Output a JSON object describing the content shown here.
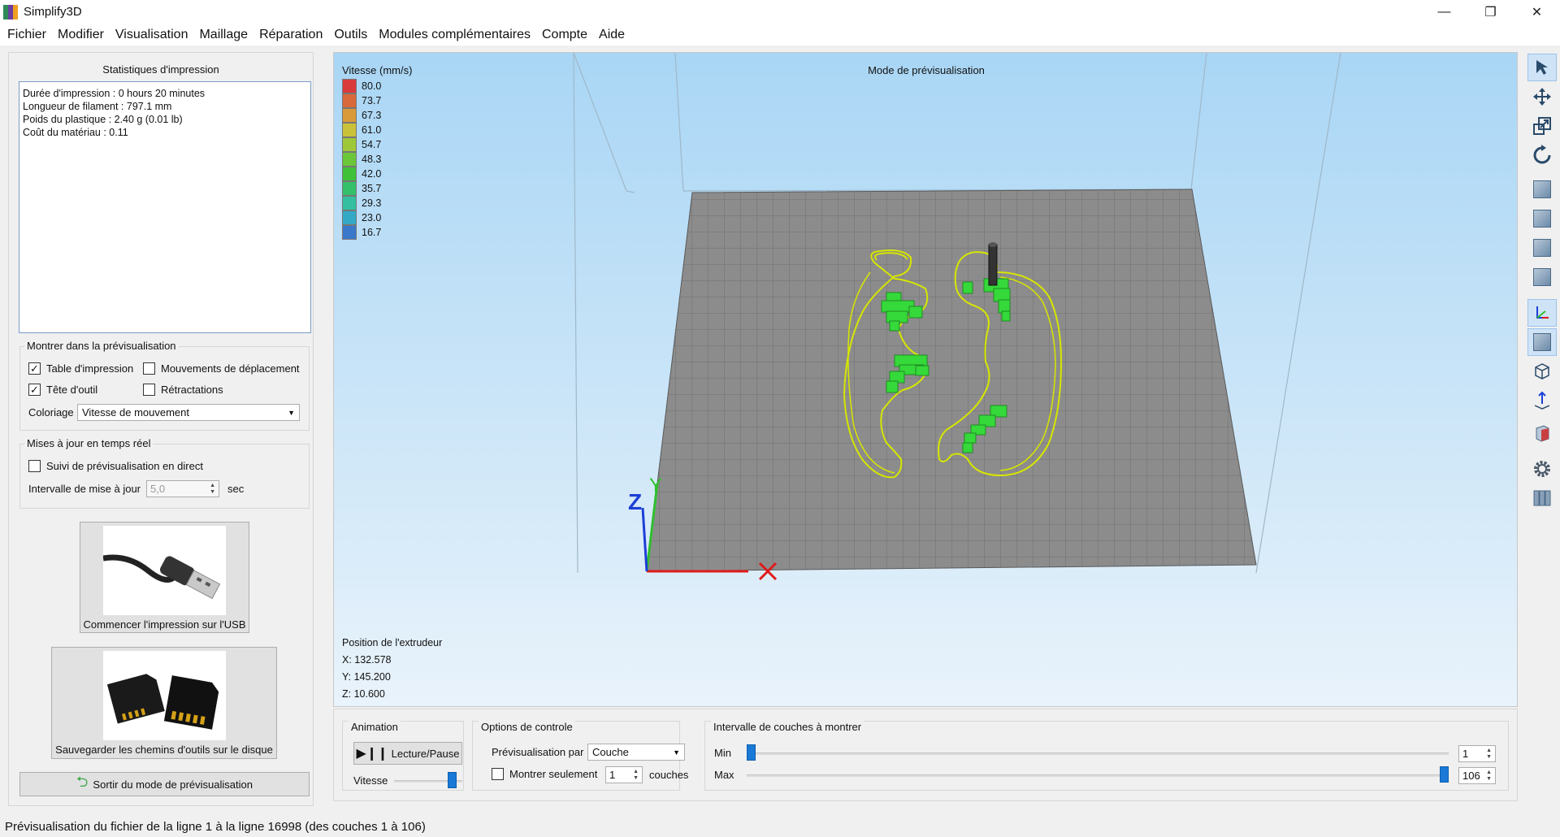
{
  "window": {
    "title": "Simplify3D",
    "minimize": "—",
    "maximize": "❐",
    "close": "✕"
  },
  "menu": [
    "Fichier",
    "Modifier",
    "Visualisation",
    "Maillage",
    "Réparation",
    "Outils",
    "Modules complémentaires",
    "Compte",
    "Aide"
  ],
  "stats": {
    "title": "Statistiques d'impression",
    "lines": [
      "Durée d'impression : 0 hours 20 minutes",
      "Longueur de filament : 797.1 mm",
      "Poids du plastique : 2.40 g (0.01 lb)",
      "Coût du matériau : 0.11"
    ]
  },
  "preview_show": {
    "title": "Montrer dans la prévisualisation",
    "options": [
      {
        "label": "Table d'impression",
        "checked": true
      },
      {
        "label": "Mouvements de déplacement",
        "checked": false
      },
      {
        "label": "Tête d'outil",
        "checked": true
      },
      {
        "label": "Rétractations",
        "checked": false
      }
    ],
    "coloring_label": "Coloriage",
    "coloring_value": "Vitesse de mouvement"
  },
  "realtime": {
    "title": "Mises à jour en temps réel",
    "live_label": "Suivi de prévisualisation en direct",
    "live_checked": false,
    "interval_label": "Intervalle de mise à jour",
    "interval_value": "5,0",
    "interval_unit": "sec"
  },
  "actions": {
    "usb_label": "Commencer l'impression sur l'USB",
    "sd_label": "Sauvegarder les chemins d'outils sur le disque",
    "exit_label": "Sortir du mode de prévisualisation"
  },
  "viewport": {
    "title": "Mode de prévisualisation",
    "legend_title": "Vitesse (mm/s)",
    "legend": [
      {
        "value": "80.0",
        "color": "#d93a3a"
      },
      {
        "value": "73.7",
        "color": "#d9683a"
      },
      {
        "value": "67.3",
        "color": "#d99a3a"
      },
      {
        "value": "61.0",
        "color": "#c9c23a"
      },
      {
        "value": "54.7",
        "color": "#9ec83a"
      },
      {
        "value": "48.3",
        "color": "#6cc63a"
      },
      {
        "value": "42.0",
        "color": "#3fc23a"
      },
      {
        "value": "35.7",
        "color": "#34c06a"
      },
      {
        "value": "29.3",
        "color": "#33bfa0"
      },
      {
        "value": "23.0",
        "color": "#33a9c6"
      },
      {
        "value": "16.7",
        "color": "#3a78c9"
      }
    ],
    "axis_z": "Z",
    "axis_y": "Y",
    "extruder": {
      "title": "Position de l'extrudeur",
      "x": "X: 132.578",
      "y": "Y: 145.200",
      "z": "Z: 10.600"
    }
  },
  "animation": {
    "title": "Animation",
    "play_label": "Lecture/Pause",
    "speed_label": "Vitesse",
    "speed_fraction": 0.85
  },
  "control": {
    "title": "Options de controle",
    "preview_by_label": "Prévisualisation par",
    "preview_by_value": "Couche",
    "only_label": "Montrer seulement",
    "only_value": "1",
    "only_unit": "couches"
  },
  "layers": {
    "title": "Intervalle de couches à montrer",
    "min_label": "Min",
    "max_label": "Max",
    "min_value": "1",
    "max_value": "106",
    "min": 1,
    "max": 106,
    "total": 106
  },
  "status": "Prévisualisation du fichier de la ligne 1 à la ligne 16998 (des couches 1 à 106)"
}
